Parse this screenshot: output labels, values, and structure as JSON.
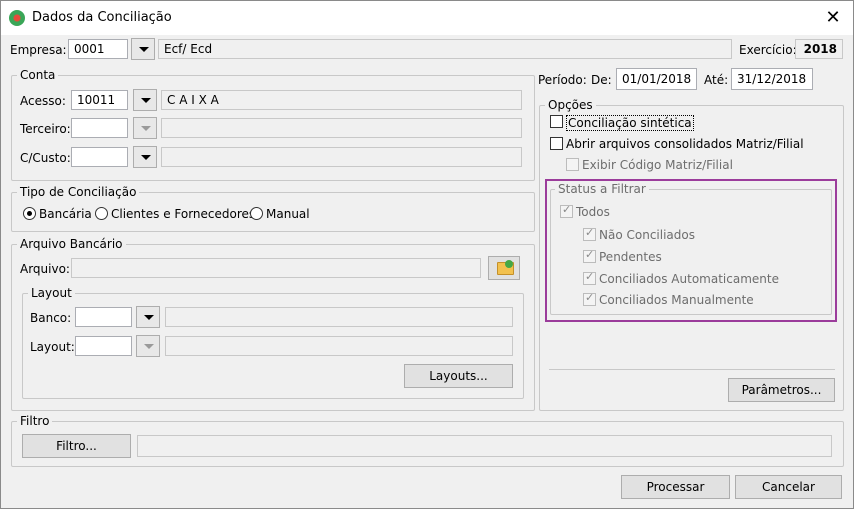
{
  "window": {
    "title": "Dados da Conciliação",
    "close_symbol": "✕"
  },
  "empresa": {
    "label": "Empresa:",
    "code": "0001",
    "name": "Ecf/ Ecd",
    "exercicio_label": "Exercício:",
    "exercicio_value": "2018"
  },
  "conta": {
    "group_label": "Conta",
    "acesso_label": "Acesso:",
    "acesso_code": "10011",
    "acesso_name": "C A I X A",
    "terceiro_label": "Terceiro:",
    "ccusto_label": "C/Custo:"
  },
  "periodo": {
    "label": "Período:",
    "de_label": "De:",
    "de_value": "01/01/2018",
    "ate_label": "Até:",
    "ate_value": "31/12/2018"
  },
  "tipo": {
    "group_label": "Tipo de Conciliação",
    "options": [
      "Bancária",
      "Clientes e Fornecedores",
      "Manual"
    ],
    "selected": "Bancária"
  },
  "arquivo": {
    "group_label": "Arquivo Bancário",
    "arquivo_label": "Arquivo:"
  },
  "layout": {
    "group_label": "Layout",
    "banco_label": "Banco:",
    "layout_label": "Layout:",
    "layouts_button": "Layouts..."
  },
  "opcoes": {
    "group_label": "Opções",
    "conciliacao_sintetica": "Conciliação sintética",
    "abrir_arquivos": "Abrir arquivos consolidados Matriz/Filial",
    "exibir_codigo": "Exibir Código Matriz/Filial",
    "parametros_button": "Parâmetros..."
  },
  "status": {
    "group_label": "Status a Filtrar",
    "todos": "Todos",
    "items": [
      "Não Conciliados",
      "Pendentes",
      "Conciliados Automaticamente",
      "Conciliados Manualmente"
    ],
    "highlight_color": "#9b3c9b"
  },
  "filtro": {
    "group_label": "Filtro",
    "button": "Filtro..."
  },
  "footer": {
    "processar": "Processar",
    "cancelar": "Cancelar"
  }
}
